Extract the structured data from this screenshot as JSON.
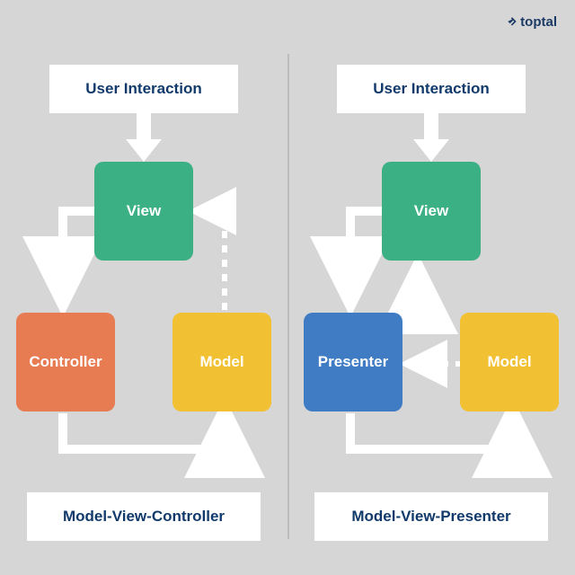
{
  "logo": "toptal",
  "left": {
    "title": "Model-View-Controller",
    "user_interaction": "User Interaction",
    "view": "View",
    "controller": "Controller",
    "model": "Model"
  },
  "right": {
    "title": "Model-View-Presenter",
    "user_interaction": "User Interaction",
    "view": "View",
    "presenter": "Presenter",
    "model": "Model"
  },
  "colors": {
    "view": "#3cb085",
    "controller": "#e77b52",
    "model": "#f2c133",
    "presenter": "#3f7cc4",
    "arrow": "#ffffff",
    "text": "#113a6b"
  }
}
